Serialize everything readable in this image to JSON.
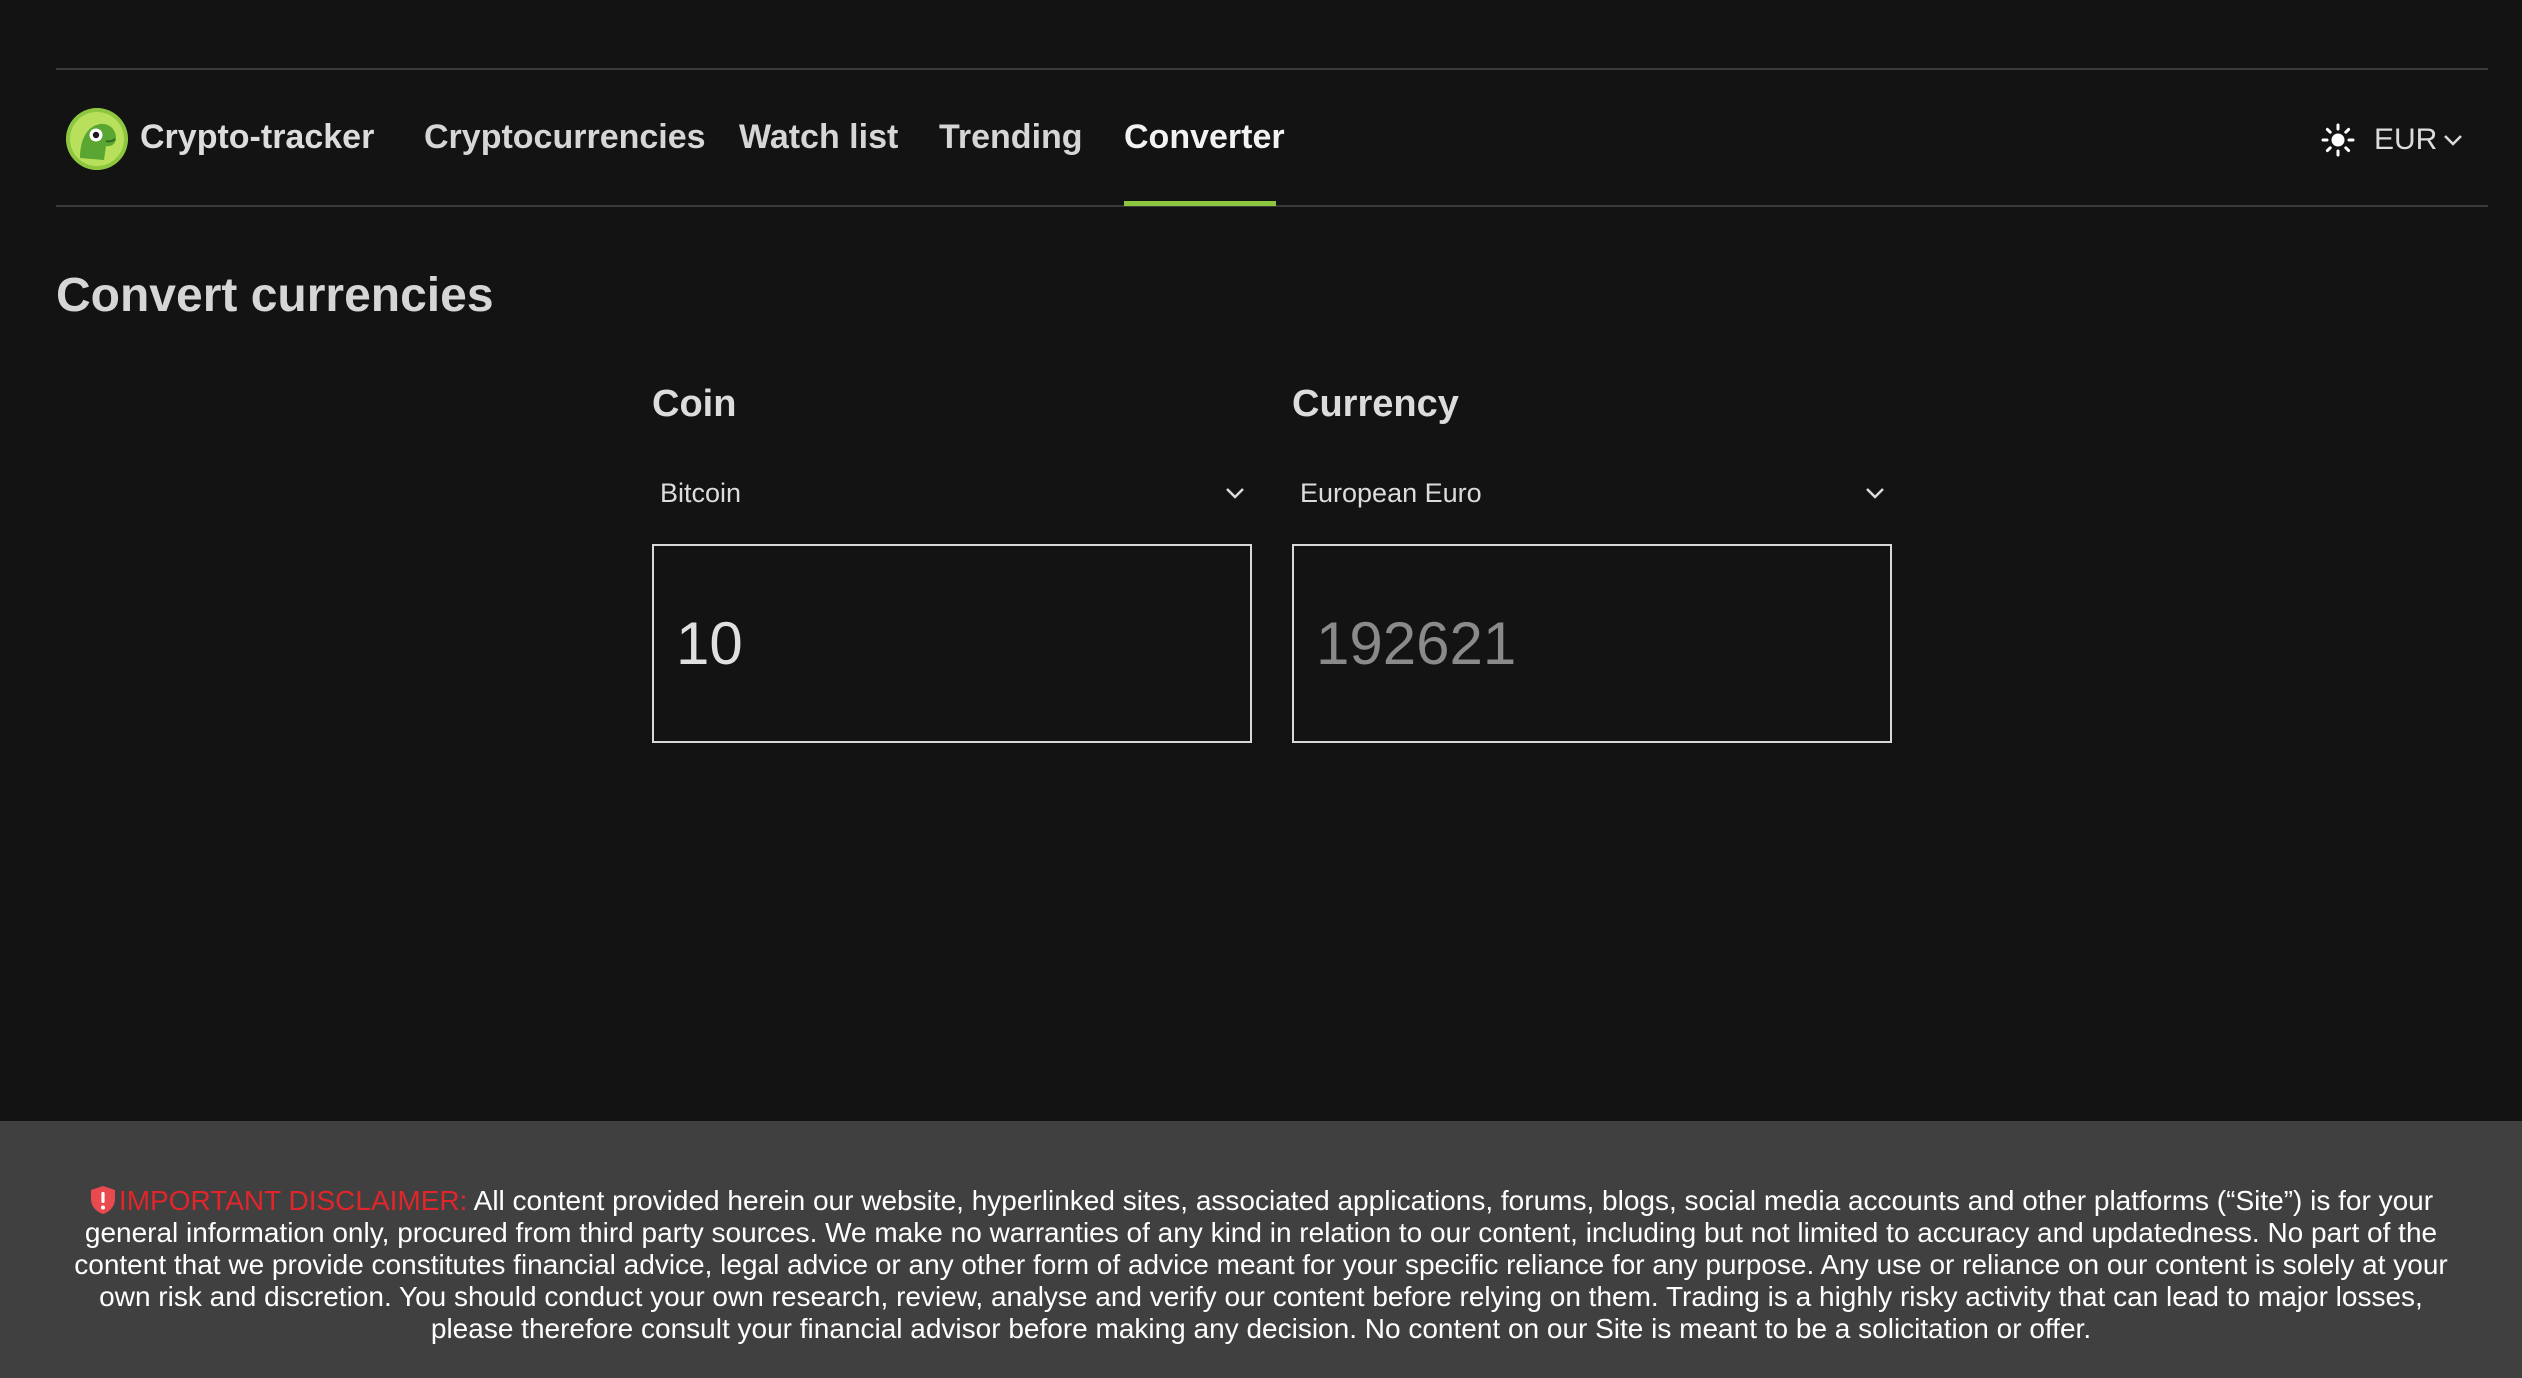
{
  "app": {
    "brand": "Crypto-tracker",
    "logo_icon": "gecko-logo-icon",
    "accent_color": "#8dc63f"
  },
  "nav": {
    "items": [
      {
        "label": "Cryptocurrencies",
        "active": false
      },
      {
        "label": "Watch list",
        "active": false
      },
      {
        "label": "Trending",
        "active": false
      },
      {
        "label": "Converter",
        "active": true
      }
    ],
    "theme_icon": "sun-icon",
    "currency": "EUR",
    "currency_icon": "chevron-down-icon"
  },
  "main": {
    "title": "Convert currencies",
    "coin": {
      "label": "Coin",
      "selected": "Bitcoin",
      "amount": "10"
    },
    "currency": {
      "label": "Currency",
      "selected": "European Euro",
      "amount": "192621"
    }
  },
  "footer": {
    "disclaimer_icon": "shield-alert-icon",
    "disclaimer_title": "IMPORTANT DISCLAIMER:",
    "disclaimer_text": "All content provided herein our website, hyperlinked sites, associated applications, forums, blogs, social media accounts and other platforms (“Site”) is for your general information only, procured from third party sources. We make no warranties of any kind in relation to our content, including but not limited to accuracy and updatedness. No part of the content that we provide constitutes financial advice, legal advice or any other form of advice meant for your specific reliance for any purpose. Any use or reliance on our content is solely at your own risk and discretion. You should conduct your own research, review, analyse and verify our content before relying on them. Trading is a highly risky activity that can lead to major losses, please therefore consult your financial advisor before making any decision. No content on our Site is meant to be a solicitation or offer.",
    "alert_color": "#e0252b"
  }
}
